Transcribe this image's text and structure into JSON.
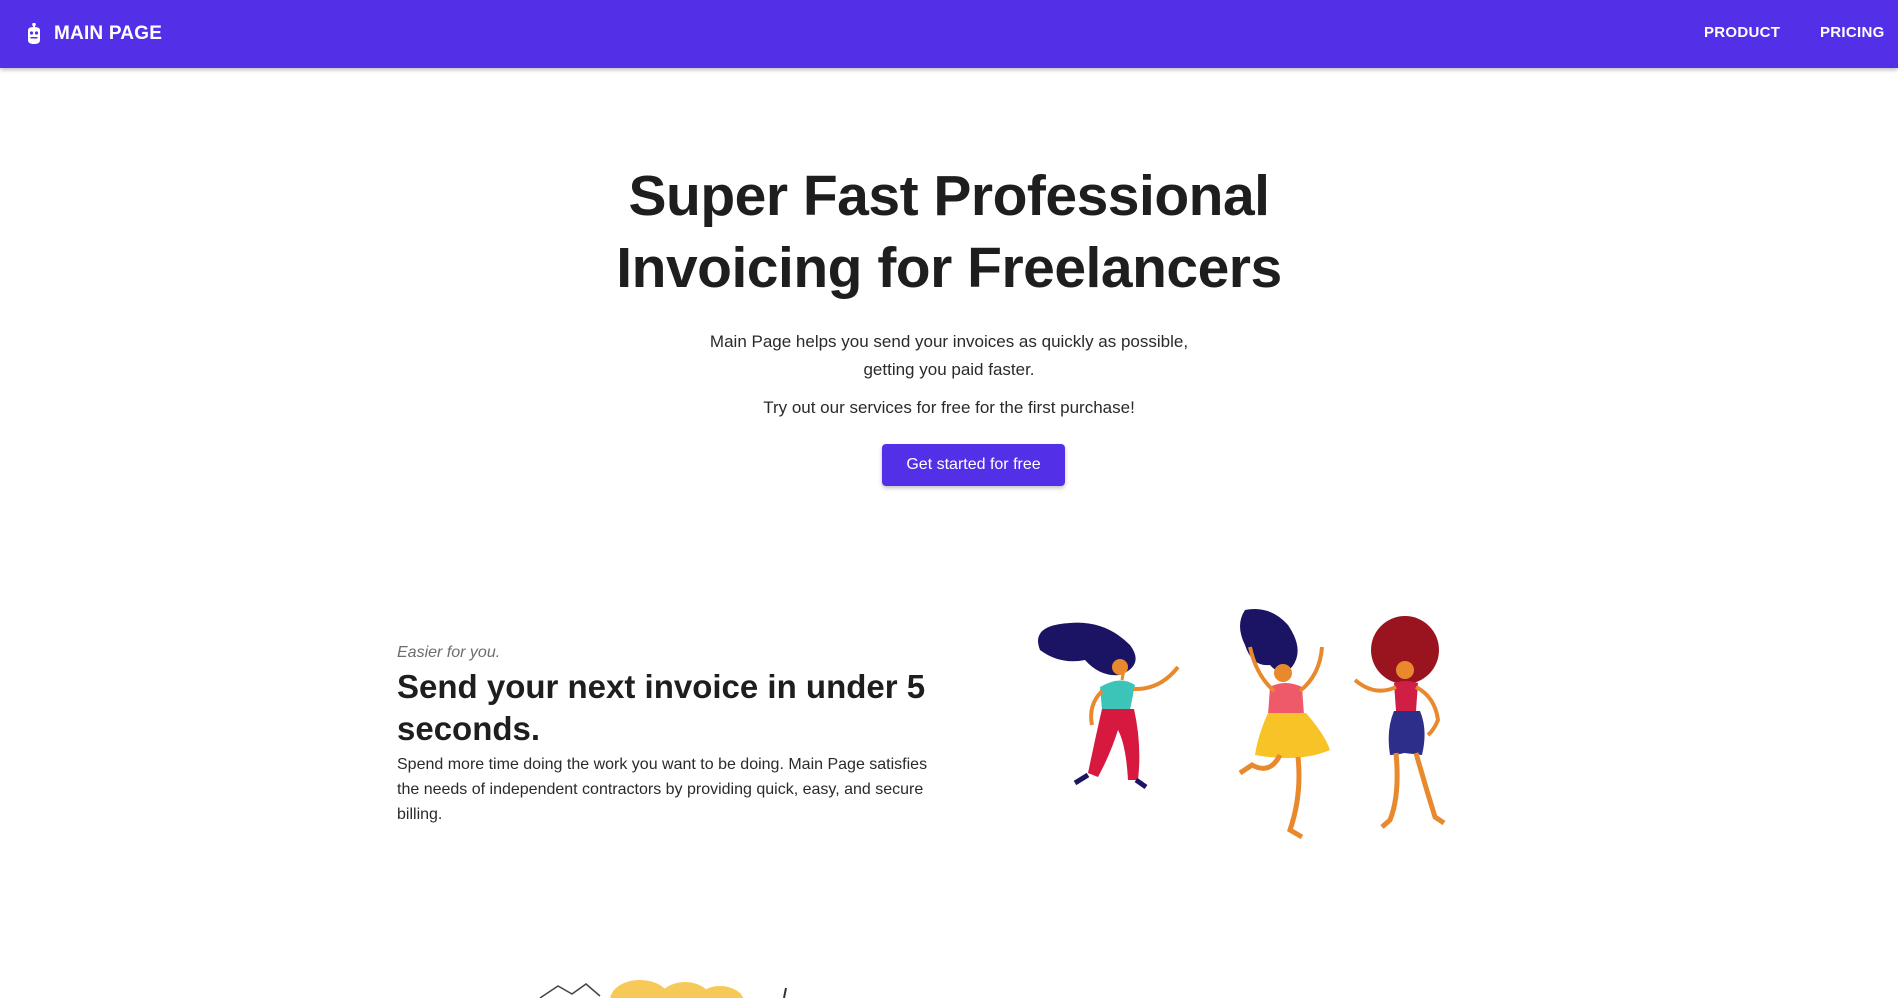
{
  "header": {
    "brand": "MAIN PAGE",
    "nav": [
      {
        "label": "PRODUCT"
      },
      {
        "label": "PRICING"
      }
    ]
  },
  "hero": {
    "title_line1": "Super Fast Professional",
    "title_line2": "Invoicing for Freelancers",
    "subtitle_line1": "Main Page helps you send your invoices as quickly as possible,",
    "subtitle_line2": "getting you paid faster.",
    "try_text": "Try out our services for free for the first purchase!",
    "cta_label": "Get started for free"
  },
  "feature": {
    "eyebrow": "Easier for you.",
    "title": "Send your next invoice in under 5 seconds.",
    "description": "Spend more time doing the work you want to be doing. Main Page satisfies the needs of independent contractors by providing quick, easy, and secure billing."
  },
  "colors": {
    "brand": "#5330e8",
    "text": "#1e1e1e"
  },
  "icons": {
    "brand_icon": "robot-icon"
  }
}
